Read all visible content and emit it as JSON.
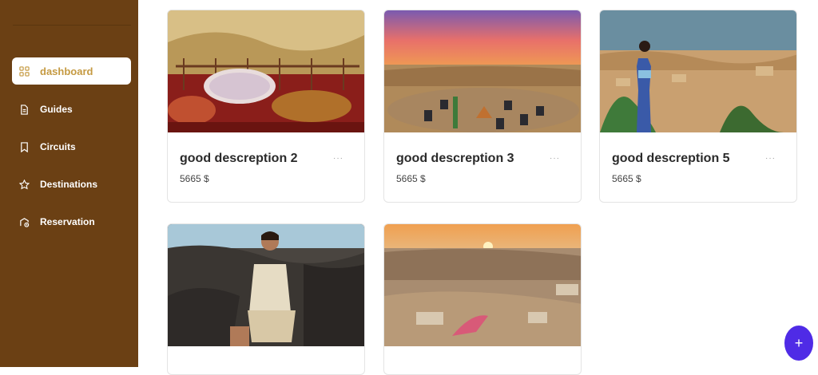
{
  "sidebar": {
    "items": [
      {
        "label": "dashboard",
        "icon": "grid-icon",
        "active": true
      },
      {
        "label": "Guides",
        "icon": "document-icon"
      },
      {
        "label": "Circuits",
        "icon": "bookmark-icon"
      },
      {
        "label": "Destinations",
        "icon": "star-icon"
      },
      {
        "label": "Reservation",
        "icon": "clock-icon"
      }
    ]
  },
  "cards": [
    {
      "title": "good descreption 2",
      "price": "5665 $",
      "more": "···"
    },
    {
      "title": "good descreption 3",
      "price": "5665 $",
      "more": "···"
    },
    {
      "title": "good descreption 5",
      "price": "5665 $",
      "more": "···"
    }
  ],
  "fab": {
    "label": "+"
  },
  "colors": {
    "sidebar": "#6b4014",
    "active_text": "#c59a42",
    "fab": "#4f2be6"
  }
}
